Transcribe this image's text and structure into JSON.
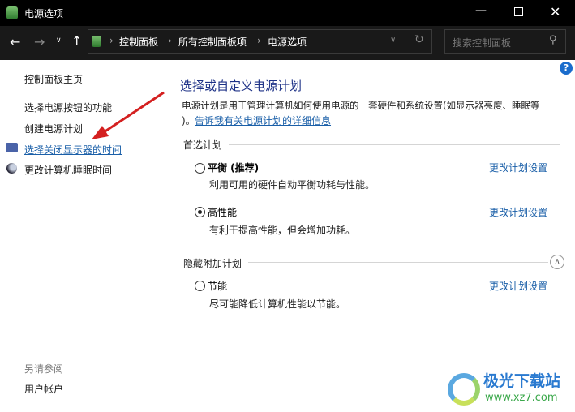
{
  "window": {
    "title": "电源选项",
    "icon": "power-options-icon"
  },
  "nav": {
    "breadcrumb": [
      "控制面板",
      "所有控制面板项",
      "电源选项"
    ],
    "search_placeholder": "搜索控制面板"
  },
  "sidebar": {
    "home": "控制面板主页",
    "items": [
      {
        "label": "选择电源按钮的功能"
      },
      {
        "label": "创建电源计划"
      },
      {
        "label": "选择关闭显示器的时间",
        "icon": "monitor-clock-icon"
      },
      {
        "label": "更改计算机睡眠时间",
        "icon": "moon-icon"
      }
    ],
    "see_also": "另请参阅",
    "see_also_items": [
      "用户帐户"
    ]
  },
  "main": {
    "title": "选择或自定义电源计划",
    "description": "电源计划是用于管理计算机如何使用电源的一套硬件和系统设置(如显示器亮度、睡眠等",
    "description2": ")。",
    "learn_more": "告诉我有关电源计划的详细信息",
    "preferred_label": "首选计划",
    "hidden_label": "隐藏附加计划",
    "plans": [
      {
        "name": "平衡 (推荐)",
        "desc": "利用可用的硬件自动平衡功耗与性能。",
        "selected": false,
        "action": "更改计划设置"
      },
      {
        "name": "高性能",
        "desc": "有利于提高性能，但会增加功耗。",
        "selected": true,
        "action": "更改计划设置"
      },
      {
        "name": "节能",
        "desc": "尽可能降低计算机性能以节能。",
        "selected": false,
        "action": "更改计划设置"
      }
    ]
  },
  "watermark": {
    "name": "极光下载站",
    "url": "www.xz7.com"
  },
  "colors": {
    "link": "#1a5fa8",
    "title": "#1e3287",
    "arrow": "#d42020"
  }
}
